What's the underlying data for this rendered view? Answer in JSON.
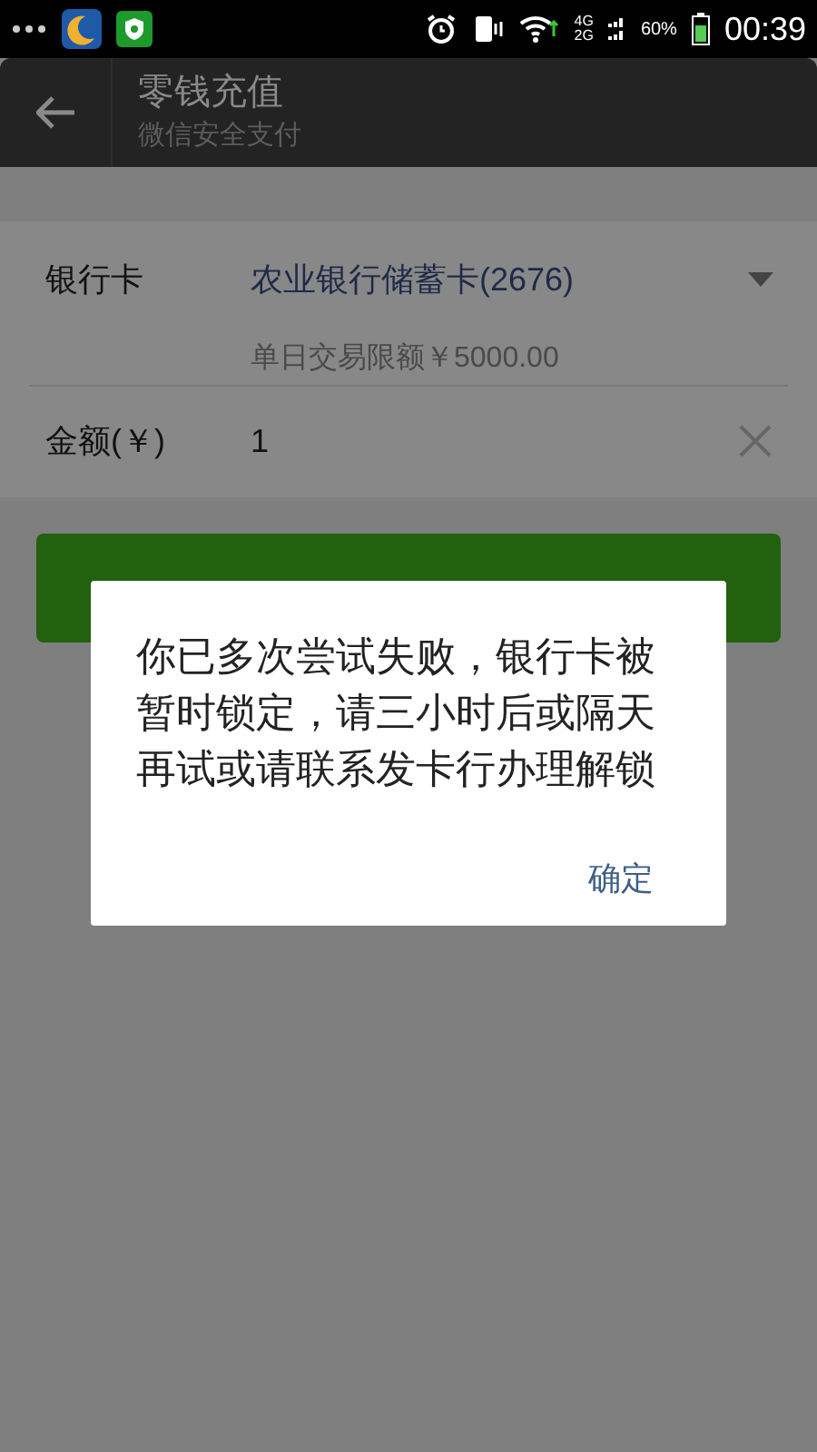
{
  "status_bar": {
    "network_top": "4G",
    "network_bottom": "2G",
    "battery": "60%",
    "time": "00:39"
  },
  "header": {
    "title": "零钱充值",
    "subtitle": "微信安全支付"
  },
  "form": {
    "bank_card": {
      "label": "银行卡",
      "value": "农业银行储蓄卡(2676)",
      "limit": "单日交易限额￥5000.00"
    },
    "amount": {
      "label": "金额(￥)",
      "value": "1"
    }
  },
  "next_button": {
    "kind": "button"
  },
  "dialog": {
    "message": "你已多次尝试失败，银行卡被暂时锁定，请三小时后或隔天再试或请联系发卡行办理解锁",
    "button": "确定"
  }
}
